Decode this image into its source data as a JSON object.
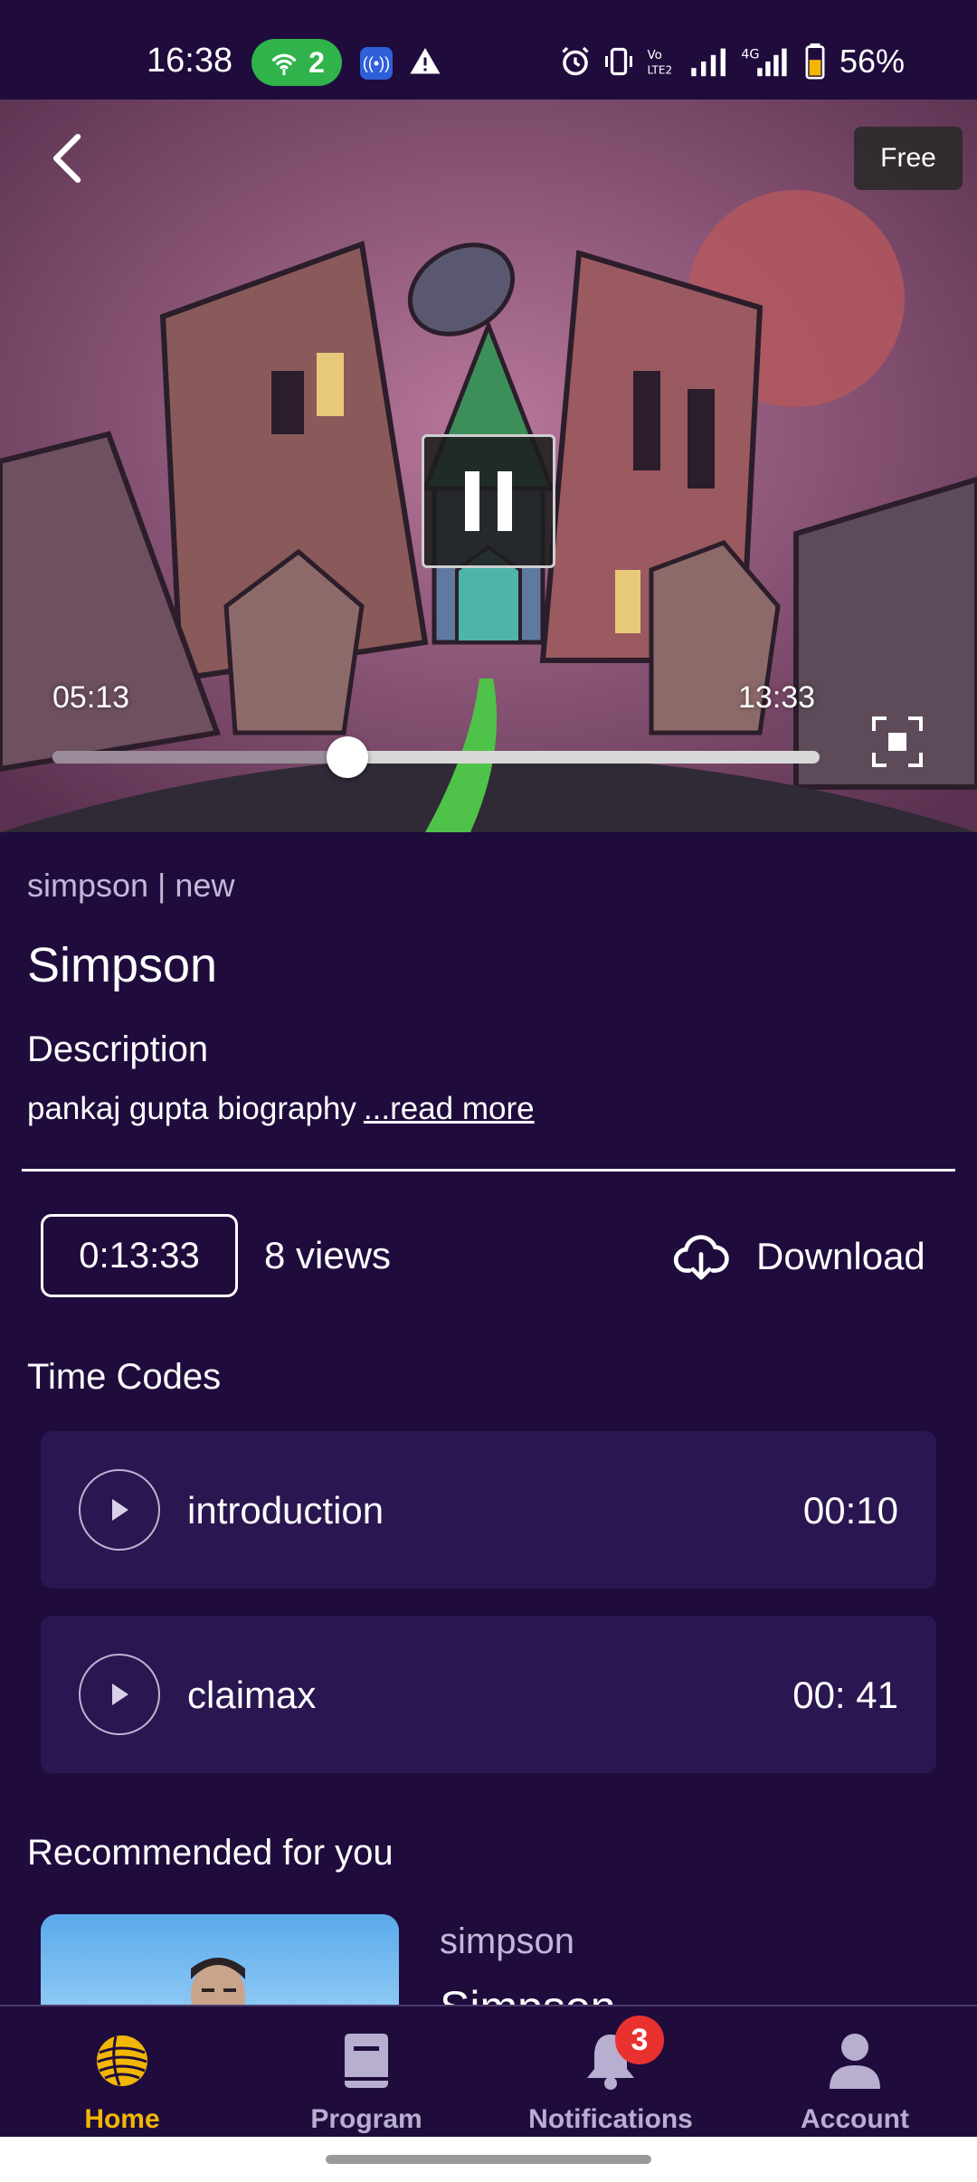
{
  "status_bar": {
    "time": "16:38",
    "hotspot_count": "2",
    "battery": "56%"
  },
  "player": {
    "badge": "Free",
    "current_time": "05:13",
    "total_time": "13:33",
    "progress_fraction": 0.385,
    "state": "playing"
  },
  "video": {
    "tags": "simpson | new",
    "title": "Simpson",
    "description_heading": "Description",
    "description_text": "pankaj gupta biography",
    "read_more": "...read more"
  },
  "stats": {
    "duration": "0:13:33",
    "views": "8 views",
    "download_label": "Download"
  },
  "time_codes": {
    "heading": "Time Codes",
    "items": [
      {
        "label": "introduction",
        "time": "00:10"
      },
      {
        "label": "claimax",
        "time": "00: 41"
      }
    ]
  },
  "recommended": {
    "heading": "Recommended for you",
    "items": [
      {
        "category": "simpson",
        "title": "Simpson"
      }
    ]
  },
  "bottom_nav": {
    "items": [
      {
        "label": "Home",
        "icon": "home-globe-icon",
        "active": true
      },
      {
        "label": "Program",
        "icon": "book-icon",
        "active": false
      },
      {
        "label": "Notifications",
        "icon": "bell-icon",
        "active": false,
        "badge": "3"
      },
      {
        "label": "Account",
        "icon": "person-icon",
        "active": false
      }
    ]
  },
  "colors": {
    "background": "#1f0c3d",
    "card": "#2a1650",
    "active_nav": "#f2b705",
    "badge": "#e9322f"
  }
}
